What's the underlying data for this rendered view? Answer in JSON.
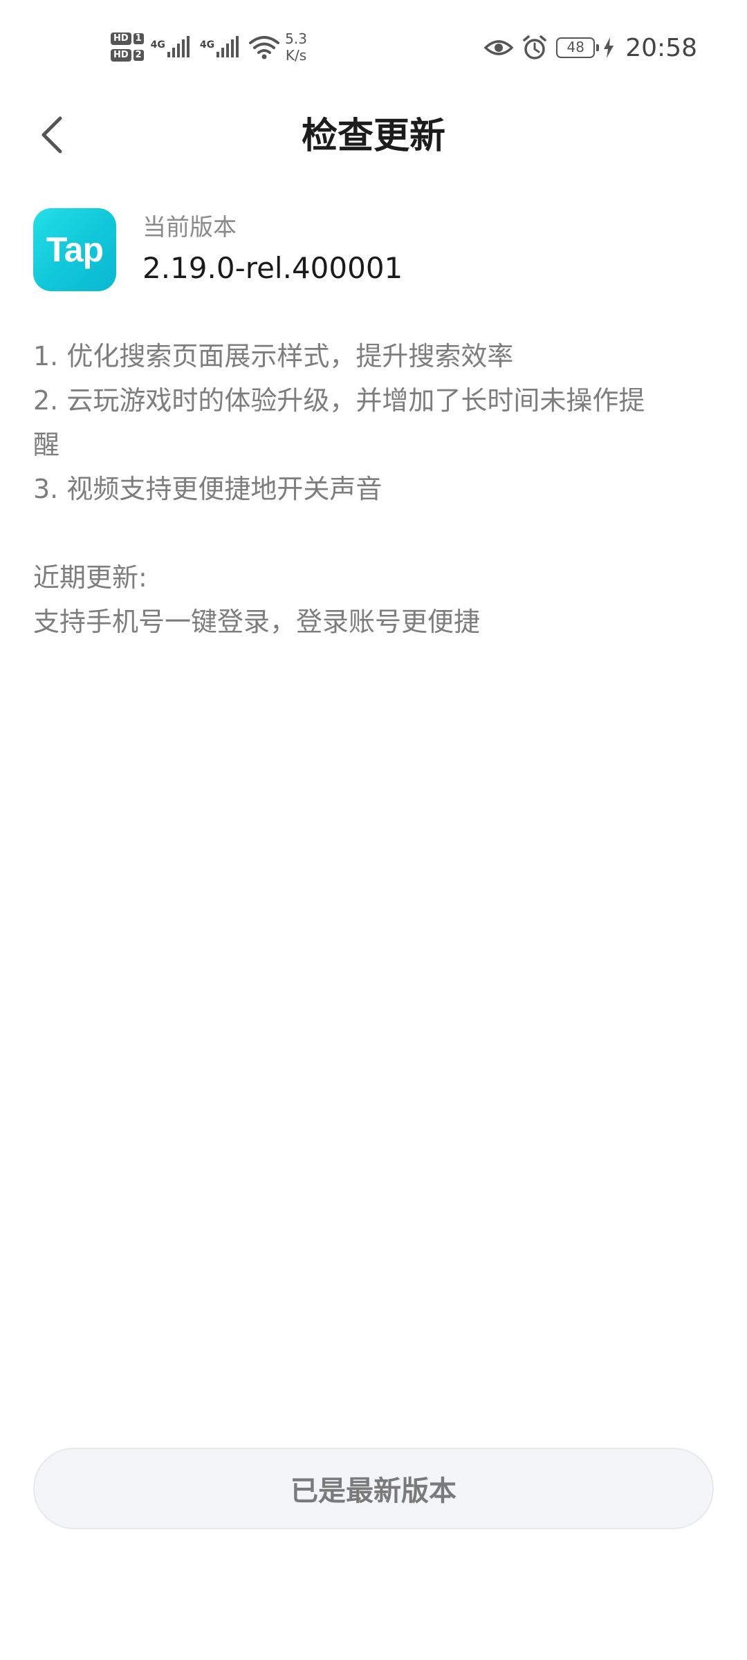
{
  "status_bar": {
    "hd_label": "HD",
    "sim1": "1",
    "sim2": "2",
    "network1": "4G",
    "network2": "4G",
    "net_speed_value": "5.3",
    "net_speed_unit": "K/s",
    "battery_level": "48",
    "time": "20:58",
    "icons": [
      "signal-icon",
      "wifi-icon",
      "eye-icon",
      "alarm-icon",
      "battery-icon",
      "charging-icon"
    ]
  },
  "header": {
    "title": "检查更新",
    "back_icon": "chevron-left-icon"
  },
  "version": {
    "app_icon_text": "Tap",
    "label": "当前版本",
    "value": "2.19.0-rel.400001",
    "icon_color": "#15cadb"
  },
  "changelog": {
    "items": [
      "1. 优化搜索页面展示样式，提升搜索效率",
      "2. 云玩游戏时的体验升级，并增加了长时间未操作提",
      "醒",
      "3. 视频支持更便捷地开关声音"
    ],
    "recent_title": "近期更新:",
    "recent_items": [
      "支持手机号一键登录，登录账号更便捷"
    ]
  },
  "footer": {
    "button_label": "已是最新版本"
  }
}
